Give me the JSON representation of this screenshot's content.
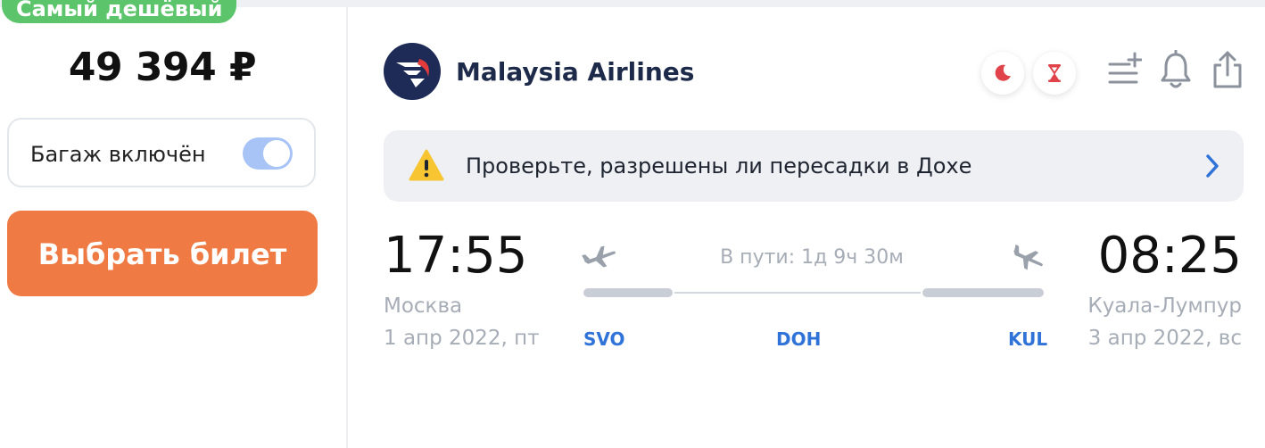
{
  "offer": {
    "badge": "Самый дешёвый",
    "price": "49 394 ₽",
    "baggage_label": "Багаж включён",
    "baggage_included": true,
    "select_button": "Выбрать билет"
  },
  "flight": {
    "airline": "Malaysia Airlines",
    "warning": "Проверьте, разрешены ли пересадки в Дохе",
    "departure": {
      "time": "17:55",
      "city": "Москва",
      "date": "1 апр 2022, пт",
      "code": "SVO"
    },
    "arrival": {
      "time": "08:25",
      "city": "Куала-Лумпур",
      "date": "3 апр 2022, вс",
      "code": "KUL"
    },
    "stop_code": "DOH",
    "duration": "В пути: 1д 9ч 30м"
  },
  "icons": {
    "night": "moon-icon",
    "long_layover": "hourglass-icon",
    "add_to_list": "add-list-icon",
    "subscribe": "bell-icon",
    "share": "share-icon",
    "warning": "warning-icon",
    "more": "chevron-right-icon"
  },
  "colors": {
    "badge": "#5cc46a",
    "primary_button": "#ef7a43",
    "toggle_on": "#a8c3f5",
    "airport_code": "#2f73d8",
    "icon_red": "#e0434a",
    "warning_bg": "#eef0f4"
  }
}
